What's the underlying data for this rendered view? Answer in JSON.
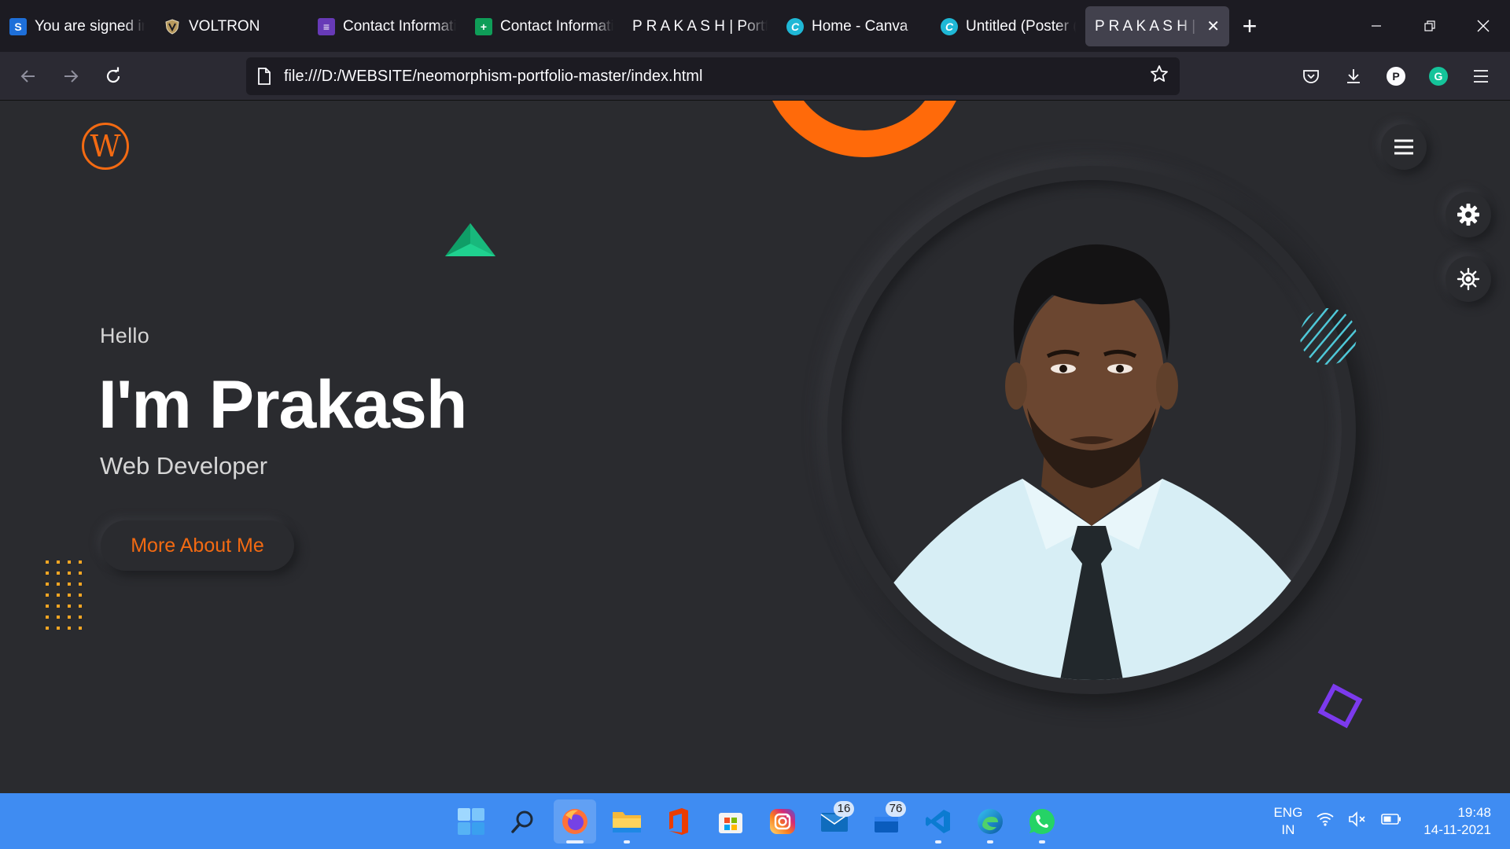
{
  "browser": {
    "tabs": [
      {
        "label": "You are signed in",
        "favicon": "s-icon"
      },
      {
        "label": "VOLTRON",
        "favicon": "shield-icon"
      },
      {
        "label": "Contact Information",
        "favicon": "forms-icon"
      },
      {
        "label": "Contact Information",
        "favicon": "sheets-icon"
      },
      {
        "label": "P R A K A S H | Portfolio",
        "favicon": ""
      },
      {
        "label": "Home - Canva",
        "favicon": "canva-icon"
      },
      {
        "label": "Untitled (Poster (",
        "favicon": "canva-icon"
      },
      {
        "label": "P R A K A S H | Ne",
        "favicon": "",
        "active": true
      }
    ],
    "tab_close_glyph": "✕",
    "new_tab_glyph": "+",
    "url": "file:///D:/WEBSITE/neomorphism-portfolio-master/index.html",
    "profile_initial": "P",
    "grammarly_initial": "G"
  },
  "page": {
    "logo_letter": "W",
    "greeting": "Hello",
    "name": "I'm Prakash",
    "role": "Web Developer",
    "cta_label": "More About Me",
    "colors": {
      "accent": "#f36a12",
      "background": "#2a2b2f",
      "triangle": "#1fd18f",
      "stripes": "#4fc8d8",
      "square": "#7c3aed"
    }
  },
  "taskbar": {
    "apps": [
      {
        "name": "start",
        "active": false
      },
      {
        "name": "search",
        "active": false
      },
      {
        "name": "firefox",
        "active": true
      },
      {
        "name": "file-explorer",
        "active": false
      },
      {
        "name": "office",
        "active": false
      },
      {
        "name": "microsoft-store",
        "active": false
      },
      {
        "name": "instagram",
        "active": false
      },
      {
        "name": "mail",
        "active": false,
        "badge": "16"
      },
      {
        "name": "todo",
        "active": false,
        "badge": "76"
      },
      {
        "name": "vscode",
        "active": false
      },
      {
        "name": "edge",
        "active": false
      },
      {
        "name": "whatsapp",
        "active": false
      }
    ],
    "lang_line1": "ENG",
    "lang_line2": "IN",
    "time": "19:48",
    "date": "14-11-2021"
  }
}
